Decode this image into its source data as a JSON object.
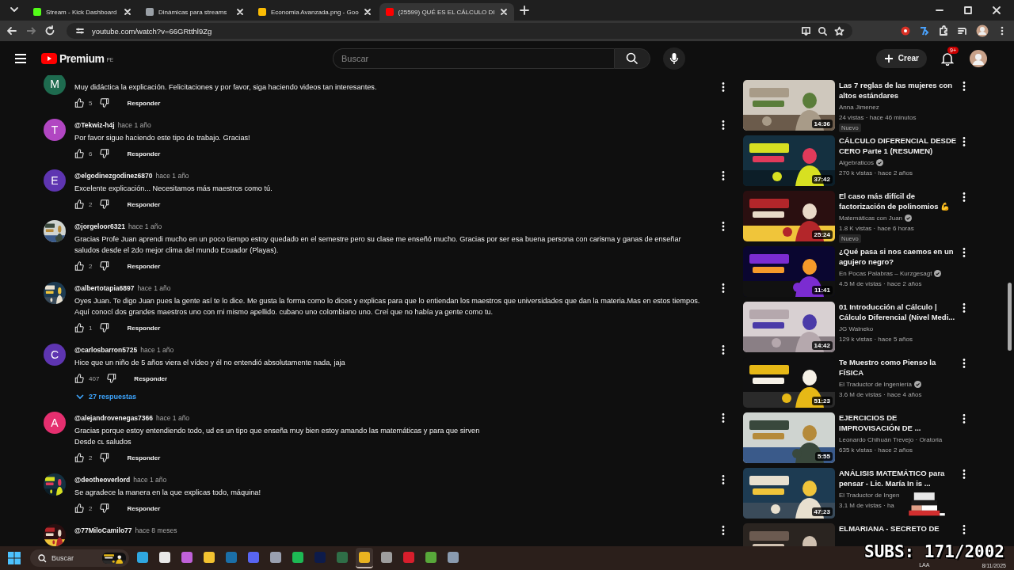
{
  "browser": {
    "tabs": [
      {
        "title": "Stream - Kick Dashboard",
        "selected": false
      },
      {
        "title": "Dinámicas para streams",
        "selected": false
      },
      {
        "title": "Economia Avanzada.png - Goo",
        "selected": false
      },
      {
        "title": "(25599) QUÉ ES EL CÁLCULO DI",
        "selected": true
      }
    ],
    "address": "youtube.com/watch?v=66GRtthl9Zg"
  },
  "header": {
    "logo": "Premium",
    "region": "PE",
    "search_placeholder": "Buscar",
    "create": "Crear",
    "notifications": "9+"
  },
  "comments": [
    {
      "text": "Muy didáctica la explicación.  Felicitaciones y por favor,  siga haciendo videos tan interesantes.",
      "likes": "5",
      "reply": "Responder",
      "avatar": {
        "kind": "letter",
        "letter": "M",
        "color": "#1e6b4f"
      }
    },
    {
      "author": "@Tekwiz-h4j",
      "time": "hace 1 año",
      "text": "Por favor sigue haciendo este tipo de trabajo. Gracias!",
      "likes": "6",
      "reply": "Responder",
      "avatar": {
        "kind": "letter",
        "letter": "T",
        "color": "#b146c2"
      }
    },
    {
      "author": "@elgodinezgodinez6870",
      "time": "hace 1 año",
      "text": "Excelente explicación... Necesitamos más maestros como tú.",
      "likes": "2",
      "reply": "Responder",
      "avatar": {
        "kind": "letter",
        "letter": "E",
        "color": "#5e35b1"
      }
    },
    {
      "author": "@jorgeloor6321",
      "time": "hace 1 año",
      "text": "Gracias Profe Juan aprendi mucho en un poco tiempo estoy quedado en el semestre pero su clase me enseñó mucho. Gracias por ser esa buena persona con carisma y ganas de enseñar\nsaludos desde el 2do mejor clima del mundo Ecuador (Playas).",
      "likes": "2",
      "reply": "Responder"
    },
    {
      "author": "@albertotapia6897",
      "time": "hace 1 año",
      "text": "Oyes Juan. Te digo Juan pues la gente así te lo dice. Me gusta la forma como lo dices y explicas para que lo entiendan los maestros que universidades que dan la materia.Mas en estos tiempos.\nAquí conocí dos grandes maestros uno con mi mismo apellido. cubano uno colombiano uno. Creí que no había ya gente como tu.",
      "likes": "1",
      "reply": "Responder"
    },
    {
      "author": "@carlosbarron5725",
      "time": "hace 1 año",
      "text": "Hice que un niño de 5 años viera el vídeo y él no entendió absolutamente nada, jaja",
      "likes": "407",
      "reply": "Responder",
      "replies": "27 respuestas",
      "avatar": {
        "kind": "letter",
        "letter": "C",
        "color": "#5e35b1"
      }
    },
    {
      "author": "@alejandrovenegas7366",
      "time": "hace 1 año",
      "text": "Gracias porque estoy entendiendo todo, ud es un tipo que enseña muy bien estoy amando las matemáticas y para que sirven\nDesde cʟ saludos",
      "likes": "2",
      "reply": "Responder",
      "avatar": {
        "kind": "letter",
        "letter": "A",
        "color": "#e52f6f"
      }
    },
    {
      "author": "@deotheoverlord",
      "time": "hace 1 año",
      "text": "Se agradece la manera en la que explicas todo, máquina!",
      "likes": "2",
      "reply": "Responder"
    },
    {
      "author": "@77MiloCamilo77",
      "time": "hace 8 meses"
    }
  ],
  "sidebar": [
    {
      "title": "Las 7 reglas de las mujeres con altos estándares",
      "channel": "Anna Jimenez",
      "verified": false,
      "meta": "24 vistas · hace 46 minutos",
      "badge": "Nuevo",
      "duration": "14:36"
    },
    {
      "title": "CÁLCULO DIFERENCIAL DESDE CERO Parte 1 (RESUMEN)",
      "channel": "Algebraticos",
      "verified": true,
      "meta": "270 k vistas · hace 2 años",
      "duration": "37:42"
    },
    {
      "title": "El caso más difícil de factorización de polinomios 💪",
      "channel": "Matemáticas con Juan",
      "verified": true,
      "meta": "1.8 K vistas · hace 6 horas",
      "badge": "Nuevo",
      "duration": "25:24"
    },
    {
      "title": "¿Qué pasa si nos caemos en un agujero negro?",
      "channel": "En Pocas Palabras – Kurzgesagt",
      "verified": true,
      "meta": "4.5 M de vistas · hace 2 años",
      "duration": "11:41"
    },
    {
      "title": "01 Introducción al Cálculo | Cálculo Diferencial (Nivel Medi...",
      "channel": "JG Walneko",
      "verified": false,
      "meta": "129 k vistas · hace 5 años",
      "duration": "14:42"
    },
    {
      "title": "Te Muestro como Pienso la FÍSICA",
      "channel": "El Traductor de Ingeniería",
      "verified": true,
      "meta": "3.6 M de vistas · hace 4 años",
      "duration": "51:23"
    },
    {
      "title": "EJERCICIOS DE IMPROVISACIÓN DE ...",
      "channel": "Leonardo Chihuán Trevejo · Oratoria",
      "verified": false,
      "meta": "635 k vistas · hace 2 años",
      "duration": "5:55"
    },
    {
      "title": "ANÁLISIS MATEMÁTICO para pensar - Lic. María In is ...",
      "channel": "El Traductor de Ingen",
      "verified": false,
      "meta": "3.1 M de vistas · ha",
      "duration": "47:23"
    },
    {
      "title": "ELMARIANA - SECRETO DE"
    }
  ],
  "overlay": {
    "subs": "SUBS: 171/2002"
  },
  "taskbar": {
    "search": "Buscar",
    "apps": [
      {
        "color": "#2fa7e0",
        "selected": false
      },
      {
        "color": "#e8e8e8",
        "selected": false
      },
      {
        "color": "#c061d9",
        "selected": false
      },
      {
        "color": "#f2c230",
        "selected": false
      },
      {
        "color": "#1b6fa8",
        "selected": false
      },
      {
        "color": "#5865f2",
        "selected": false
      },
      {
        "color": "#9aa0b0",
        "selected": false
      },
      {
        "color": "#1db954",
        "selected": false
      },
      {
        "color": "#0d1b4a",
        "selected": false
      },
      {
        "color": "#2f6e47",
        "selected": false
      },
      {
        "color": "#e9b320",
        "selected": true
      },
      {
        "color": "#9e9e9e",
        "selected": false
      },
      {
        "color": "#d81e2c",
        "selected": false
      },
      {
        "color": "#58a83a",
        "selected": false
      },
      {
        "color": "#8a9bb0",
        "selected": false
      }
    ],
    "lang": "LAA",
    "date": "8/11/2025"
  }
}
